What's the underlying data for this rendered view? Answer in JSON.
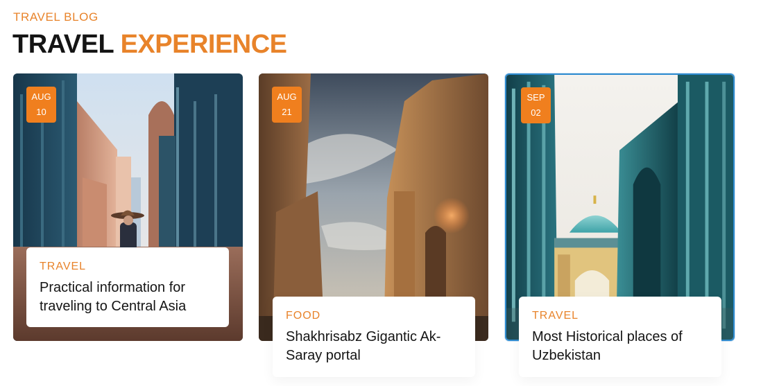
{
  "header": {
    "eyebrow": "TRAVEL BLOG",
    "title_part1": "TRAVEL",
    "title_part2": "EXPERIENCE"
  },
  "colors": {
    "accent": "#E8832A",
    "badge": "#F07F1E",
    "heading": "#141414",
    "selection_border": "#2E8BD0"
  },
  "posts": [
    {
      "date_month": "AUG",
      "date_day": "10",
      "category": "TRAVEL",
      "title": "Practical information for traveling to Central Asia",
      "image": "woman-in-hat-between-tiled-walls"
    },
    {
      "date_month": "AUG",
      "date_day": "21",
      "category": "FOOD",
      "title": "Shakhrisabz Gigantic Ak-Saray portal",
      "image": "ak-saray-ruined-portal-at-sunset"
    },
    {
      "date_month": "SEP",
      "date_day": "02",
      "category": "TRAVEL",
      "title": "Most Historical places of Uzbekistan",
      "image": "turquoise-dome-between-blue-tiled-walls",
      "selected": true
    }
  ]
}
